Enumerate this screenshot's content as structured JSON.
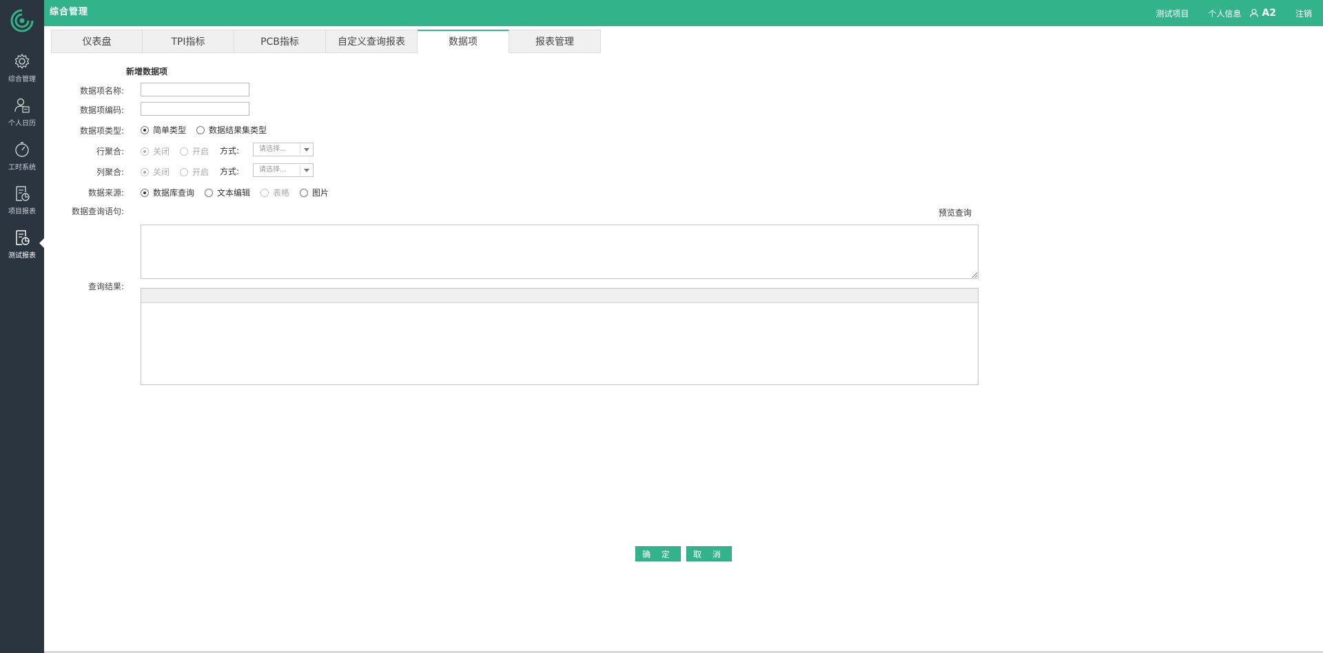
{
  "app": {
    "title": "综合管理"
  },
  "header": {
    "project_link": "测试项目",
    "profile_link": "个人信息",
    "username": "A2",
    "logout": "注销"
  },
  "sidebar": {
    "items": [
      {
        "label": "综合管理",
        "icon": "gear-icon"
      },
      {
        "label": "个人日历",
        "icon": "user-calendar-icon"
      },
      {
        "label": "工时系统",
        "icon": "stopwatch-icon"
      },
      {
        "label": "项目报表",
        "icon": "report-chart-icon"
      },
      {
        "label": "测试报表",
        "icon": "report-chart-icon",
        "active": true
      }
    ]
  },
  "tabs": [
    {
      "label": "仪表盘"
    },
    {
      "label": "TPI指标"
    },
    {
      "label": "PCB指标"
    },
    {
      "label": "自定义查询报表"
    },
    {
      "label": "数据项",
      "active": true
    },
    {
      "label": "报表管理"
    }
  ],
  "form": {
    "title": "新增数据项",
    "name_label": "数据项名称:",
    "name_value": "",
    "code_label": "数据项编码:",
    "code_value": "",
    "type_label": "数据项类型:",
    "type_options": [
      "简单类型",
      "数据结果集类型"
    ],
    "type_selected": "简单类型",
    "row_agg_label": "行聚合:",
    "col_agg_label": "列聚合:",
    "agg_options": [
      "关闭",
      "开启"
    ],
    "agg_selected": "关闭",
    "mode_label": "方式:",
    "mode_placeholder": "请选择...",
    "source_label": "数据来源:",
    "source_options": [
      "数据库查询",
      "文本编辑",
      "表格",
      "图片"
    ],
    "source_selected": "数据库查询",
    "sql_label": "数据查询语句:",
    "preview_link": "预览查询",
    "sql_value": "",
    "result_label": "查询结果:"
  },
  "buttons": {
    "confirm": "确 定",
    "cancel": "取 消"
  },
  "colors": {
    "accent": "#33b38a",
    "sidebar": "#2b3540"
  }
}
